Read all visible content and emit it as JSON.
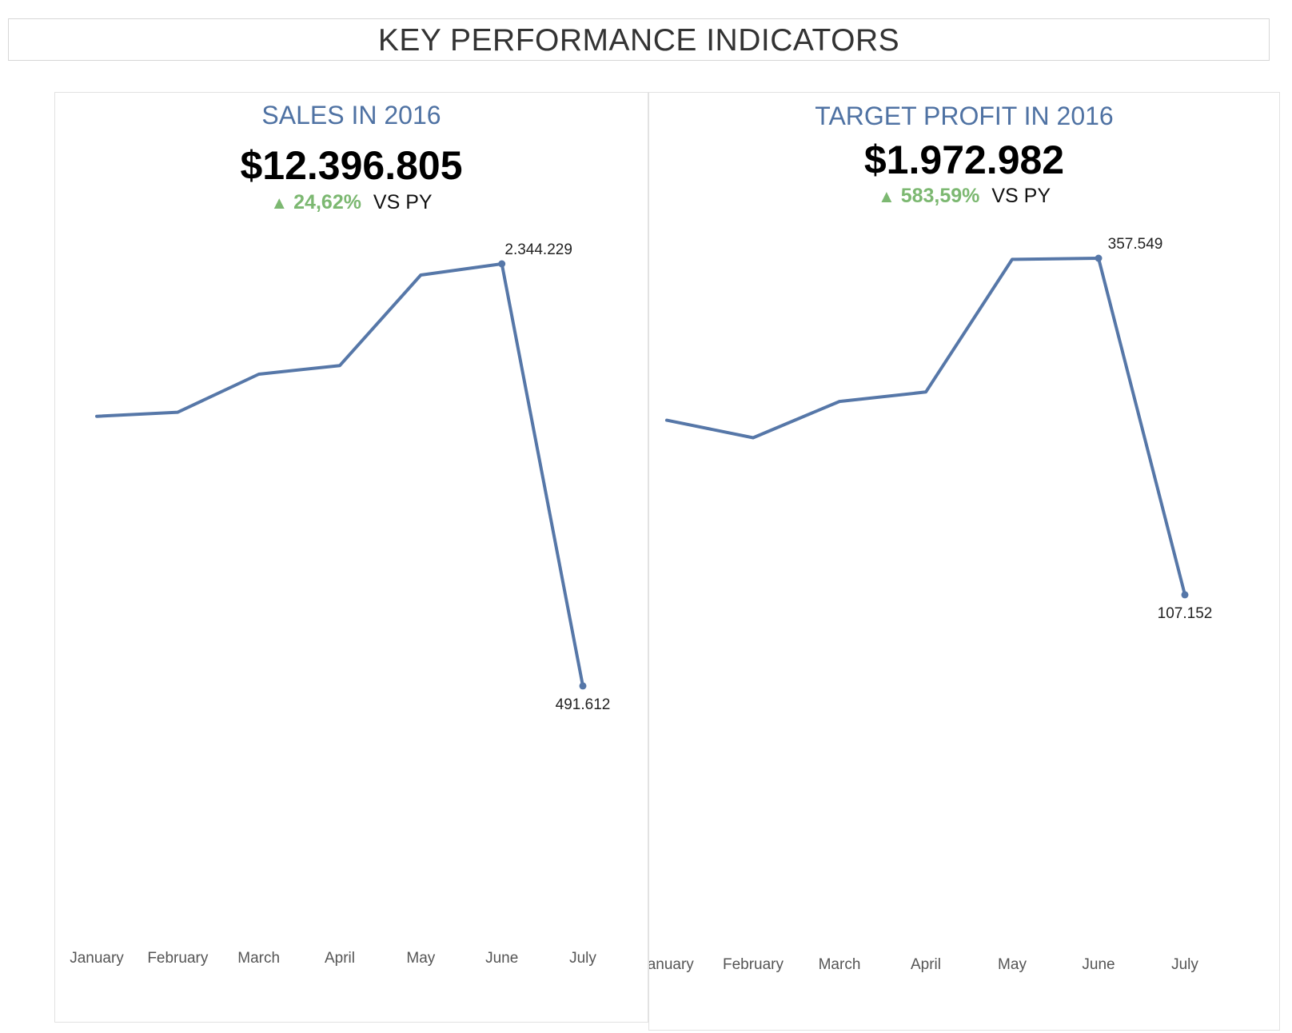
{
  "header": {
    "title": "KEY PERFORMANCE INDICATORS"
  },
  "panels": [
    {
      "title": "SALES IN 2016",
      "kpi": "$12.396.805",
      "delta_symbol": "▲",
      "delta_pct": "24,62%",
      "delta_suffix": "VS PY"
    },
    {
      "title": "TARGET PROFIT IN 2016",
      "kpi": "$1.972.982",
      "delta_symbol": "▲",
      "delta_pct": "583,59%",
      "delta_suffix": "VS PY"
    }
  ],
  "colors": {
    "line": "#5677a8",
    "positive": "#7cb871",
    "title": "#4f72a3"
  },
  "chart_data": [
    {
      "type": "line",
      "categories": [
        "January",
        "February",
        "March",
        "April",
        "May",
        "June",
        "July"
      ],
      "values": [
        1675000,
        1693000,
        1860000,
        1898000,
        2295000,
        2344229,
        491612
      ],
      "labels": [
        null,
        null,
        null,
        null,
        null,
        "2.344.229",
        "491.612"
      ],
      "ylim": [
        0,
        2344229
      ],
      "grid": false,
      "legend": "none"
    },
    {
      "type": "line",
      "categories": [
        "January",
        "February",
        "March",
        "April",
        "May",
        "June",
        "July"
      ],
      "values": [
        237000,
        224000,
        251000,
        258000,
        356700,
        357549,
        107152
      ],
      "labels": [
        null,
        null,
        null,
        null,
        null,
        "357.549",
        "107.152"
      ],
      "ylim": [
        0,
        357549
      ],
      "grid": false,
      "legend": "none"
    }
  ]
}
